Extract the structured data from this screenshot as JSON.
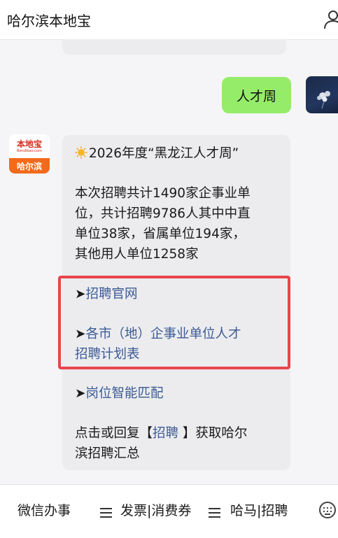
{
  "header": {
    "title": "哈尔滨本地宝"
  },
  "chat": {
    "user_message": "人才周",
    "bot_avatar": {
      "brand": "本地宝",
      "domain": "Bendibao.com",
      "city": "哈尔滨"
    },
    "bot_message": {
      "title": "2026年度“黑龙江人才周”",
      "body_lines": [
        "本次招聘共计1490家企事业单",
        "位，共计招聘9786人其中中直",
        "单位38家，省属单位194家，",
        "其他用人单位1258家"
      ],
      "arrow": "➤",
      "links": {
        "official_site": "招聘官网",
        "plan_line1": "各市（地）企事业单位人才",
        "plan_line2": "招聘计划表",
        "smart_match": "岗位智能匹配"
      },
      "reply_prefix": "点击或回复【",
      "reply_keyword": "招聘",
      "reply_suffix": " 】获取哈尔",
      "reply_line2": "滨招聘汇总"
    }
  },
  "footer": {
    "items": [
      "微信办事",
      "发票|消费券",
      "哈马|招聘"
    ]
  },
  "colors": {
    "user_bubble": "#95ec69",
    "bot_bubble": "#ececef",
    "link": "#3b5a93",
    "highlight_border": "#e8454d",
    "brand_orange": "#f26a1b"
  }
}
